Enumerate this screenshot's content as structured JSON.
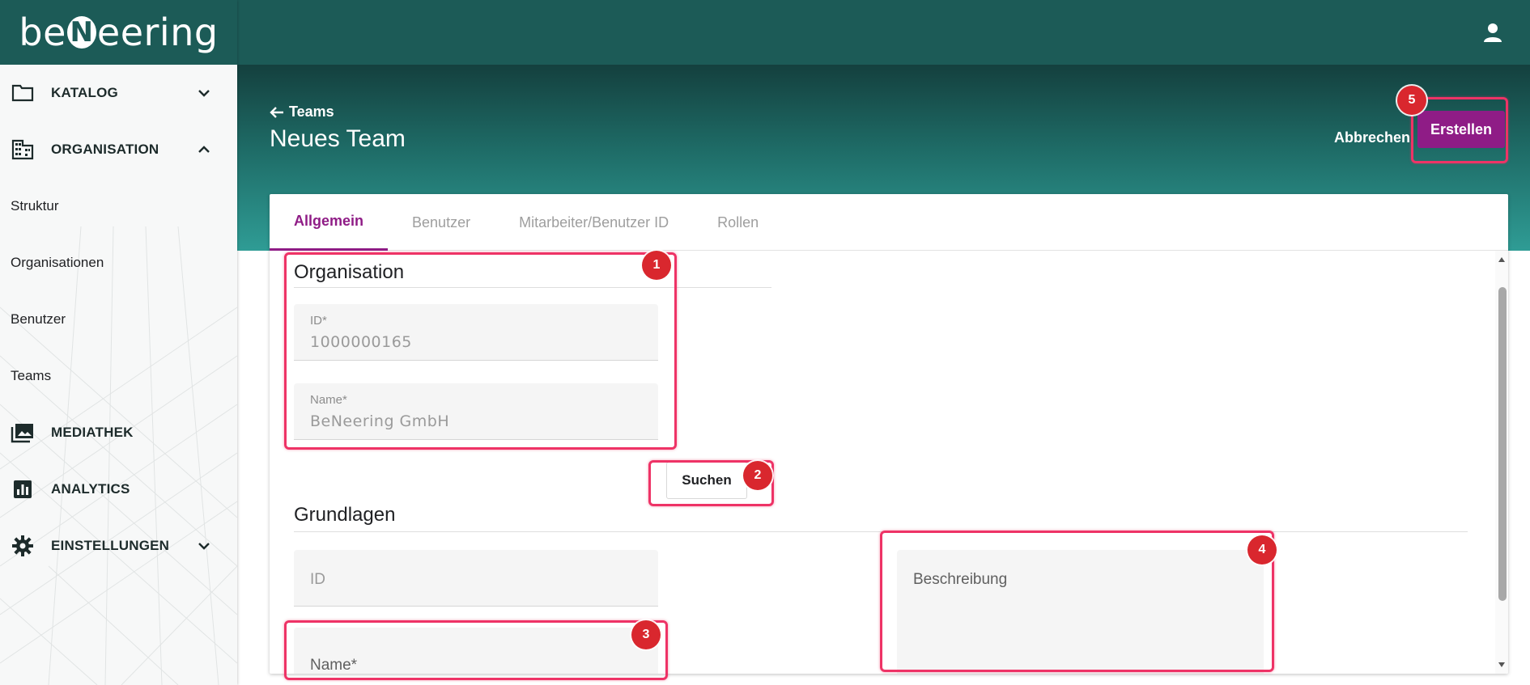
{
  "brand": {
    "logo_text_before": "be",
    "logo_mark": "N",
    "logo_text_after": "eering"
  },
  "sidebar": {
    "items": [
      {
        "label": "KATALOG",
        "icon": "folder-icon",
        "expanded": false
      },
      {
        "label": "ORGANISATION",
        "icon": "building-icon",
        "expanded": true
      },
      {
        "label": "MEDIATHEK",
        "icon": "photo-library-icon",
        "expanded": false
      },
      {
        "label": "ANALYTICS",
        "icon": "bar-chart-icon",
        "expanded": false
      },
      {
        "label": "EINSTELLUNGEN",
        "icon": "gear-icon",
        "expanded": false
      }
    ],
    "sub_items": [
      "Struktur",
      "Organisationen",
      "Benutzer",
      "Teams"
    ]
  },
  "header": {
    "user_icon": "person-icon",
    "back_label": "Teams",
    "title": "Neues Team",
    "cancel_label": "Abbrechen",
    "create_label": "Erstellen"
  },
  "tabs": [
    {
      "label": "Allgemein",
      "active": true
    },
    {
      "label": "Benutzer",
      "active": false
    },
    {
      "label": "Mitarbeiter/Benutzer ID",
      "active": false
    },
    {
      "label": "Rollen",
      "active": false
    }
  ],
  "organisation_section": {
    "title": "Organisation",
    "id_label": "ID*",
    "id_value": "1000000165",
    "name_label": "Name*",
    "name_value": "BeNeering GmbH",
    "search_label": "Suchen"
  },
  "grundlagen_section": {
    "title": "Grundlagen",
    "id_placeholder": "ID",
    "name_placeholder": "Name*",
    "description_placeholder": "Beschreibung"
  },
  "annotations": [
    "1",
    "2",
    "3",
    "4",
    "5"
  ],
  "colors": {
    "brand_teal": "#1c5b57",
    "accent_purple": "#8f1c86",
    "highlight": "#ee3366",
    "badge_red": "#d9272e"
  }
}
